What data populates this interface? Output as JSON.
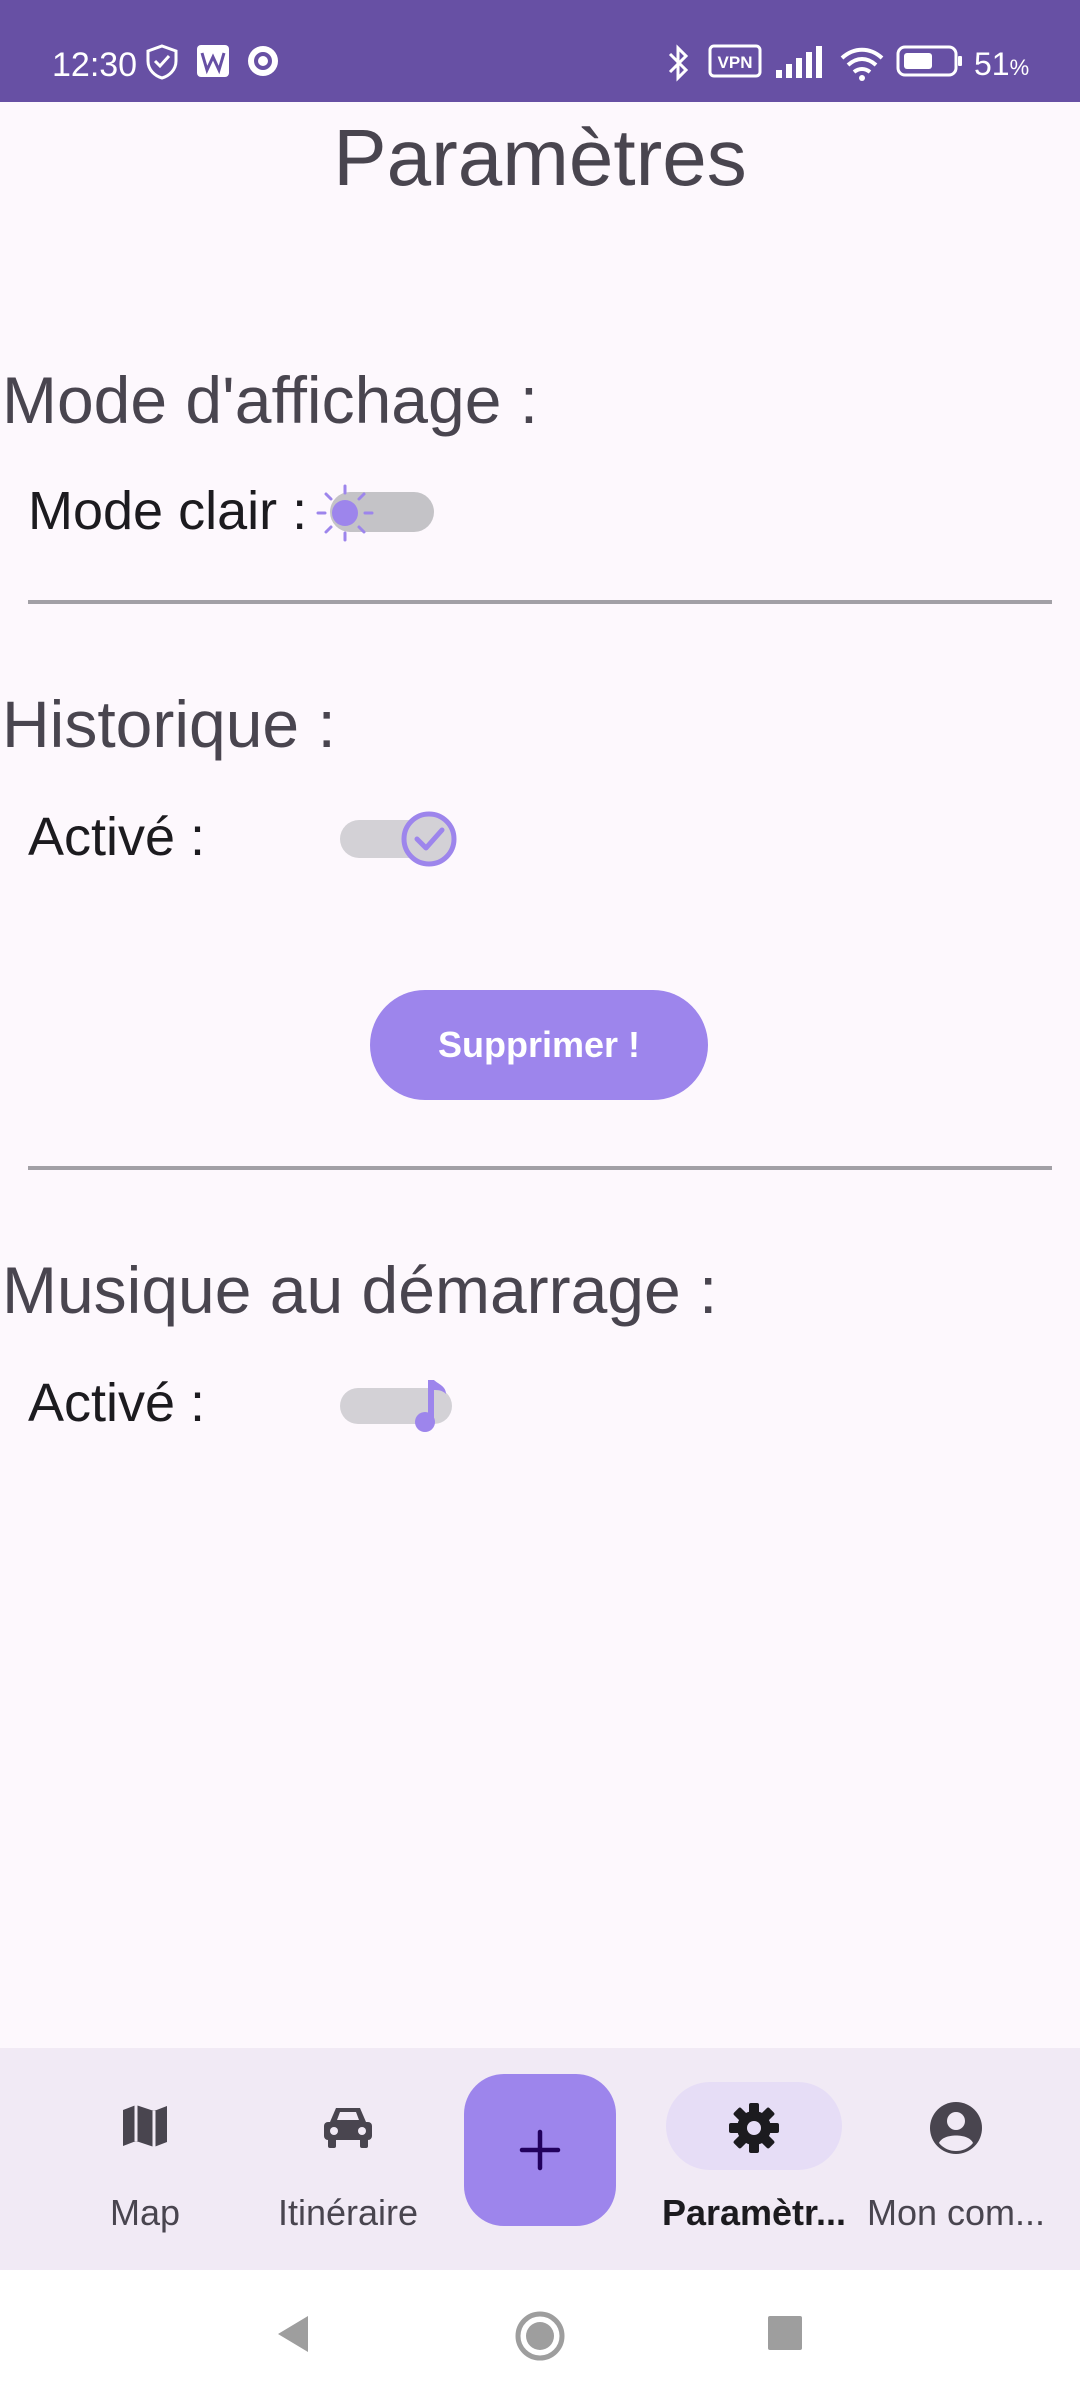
{
  "status_bar": {
    "time": "12:30",
    "battery": "51",
    "battery_unit": "%",
    "vpn_label": "VPN",
    "icons": [
      "shield-icon",
      "w-app-icon",
      "circle-app-icon",
      "bluetooth-icon",
      "vpn-icon",
      "signal-icon",
      "wifi-icon",
      "battery-icon"
    ]
  },
  "page": {
    "title": "Paramètres"
  },
  "display_mode": {
    "title": "Mode d'affichage :",
    "label": "Mode clair :",
    "icon": "sun-icon",
    "enabled": false
  },
  "history": {
    "title": "Historique :",
    "label": "Activé :",
    "icon": "check-icon",
    "enabled": true,
    "delete_label": "Supprimer !"
  },
  "music": {
    "title": "Musique au démarrage :",
    "label": "Activé :",
    "icon": "music-note-icon",
    "enabled": true
  },
  "bottom_nav": {
    "items": [
      {
        "label": "Map",
        "icon": "map-icon",
        "active": false
      },
      {
        "label": "Itinéraire",
        "icon": "car-icon",
        "active": false
      },
      {
        "label": "",
        "icon": "plus-icon",
        "active": false
      },
      {
        "label": "Paramètr...",
        "icon": "gear-icon",
        "active": true
      },
      {
        "label": "Mon com...",
        "icon": "account-icon",
        "active": false
      }
    ]
  },
  "colors": {
    "status_bar": "#6750a4",
    "accent": "#9d85ec",
    "background": "#fdf8fd",
    "nav_background": "#f1eaf5"
  }
}
